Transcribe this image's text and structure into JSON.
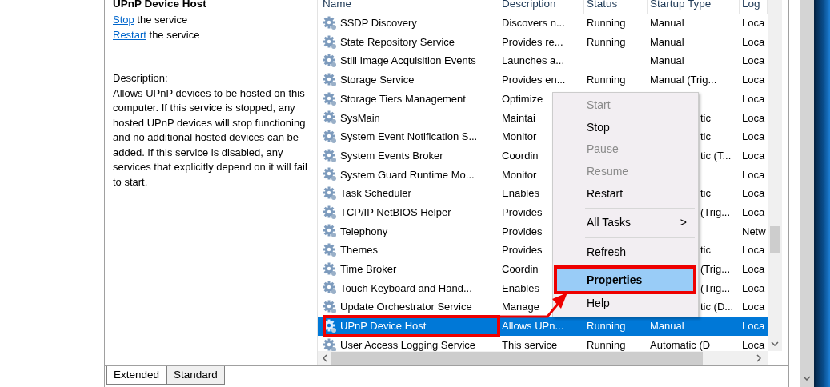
{
  "details": {
    "title": "UPnP Device Host",
    "actions": [
      {
        "link": "Stop",
        "text": "the service"
      },
      {
        "link": "Restart",
        "text": "the service"
      }
    ],
    "description_label": "Description:",
    "description": "Allows UPnP devices to be hosted on this computer. If this service is stopped, any hosted UPnP devices will stop functioning and no additional hosted devices can be added. If this service is disabled, any services that explicitly depend on it will fail to start."
  },
  "table": {
    "columns": [
      "Name",
      "Description",
      "Status",
      "Startup Type",
      "Log"
    ],
    "rows": [
      {
        "name": "SSDP Discovery",
        "description": "Discovers n...",
        "status": "Running",
        "startup": "Manual",
        "log": "Loca",
        "selected": false
      },
      {
        "name": "State Repository Service",
        "description": "Provides re...",
        "status": "Running",
        "startup": "Manual",
        "log": "Loca",
        "selected": false
      },
      {
        "name": "Still Image Acquisition Events",
        "description": "Launches a...",
        "status": "",
        "startup": "Manual",
        "log": "Loca",
        "selected": false
      },
      {
        "name": "Storage Service",
        "description": "Provides en...",
        "status": "Running",
        "startup": "Manual (Trig...",
        "log": "Loca",
        "selected": false
      },
      {
        "name": "Storage Tiers Management",
        "description": "Optimize",
        "startup_tail": "",
        "log": "Loca",
        "selected": false
      },
      {
        "name": "SysMain",
        "description": "Maintai",
        "startup_tail": "tic",
        "log": "Loca",
        "selected": false
      },
      {
        "name": "System Event Notification S...",
        "description": "Monitor",
        "startup_tail": "tic",
        "log": "Loca",
        "selected": false
      },
      {
        "name": "System Events Broker",
        "description": "Coordin",
        "startup_tail": "tic (T...",
        "log": "Loca",
        "selected": false
      },
      {
        "name": "System Guard Runtime Mo...",
        "description": "Monitor",
        "startup_tail": "",
        "log": "Loca",
        "selected": false
      },
      {
        "name": "Task Scheduler",
        "description": "Enables",
        "startup_tail": "tic",
        "log": "Loca",
        "selected": false
      },
      {
        "name": "TCP/IP NetBIOS Helper",
        "description": "Provides",
        "startup_tail": "(Trig...",
        "log": "Loca",
        "selected": false
      },
      {
        "name": "Telephony",
        "description": "Provides",
        "startup_tail": "",
        "log": "Netw",
        "selected": false
      },
      {
        "name": "Themes",
        "description": "Provides",
        "startup_tail": "tic",
        "log": "Loca",
        "selected": false
      },
      {
        "name": "Time Broker",
        "description": "Coordin",
        "startup_tail": "(Trig...",
        "log": "Loca",
        "selected": false
      },
      {
        "name": "Touch Keyboard and Hand...",
        "description": "Enables",
        "startup_tail": "(Trig...",
        "log": "Loca",
        "selected": false
      },
      {
        "name": "Update Orchestrator Service",
        "description": "Manage",
        "startup_tail": "tic (D...",
        "log": "Loca",
        "selected": false
      },
      {
        "name": "UPnP Device Host",
        "description": "Allows UPn...",
        "status": "Running",
        "startup": "Manual",
        "log": "Loca",
        "selected": true
      },
      {
        "name": "User Access Logging Service",
        "description": "This service",
        "status": "Running",
        "startup": "Automatic (D",
        "log": "Loca",
        "selected": false
      }
    ]
  },
  "context_menu": [
    {
      "kind": "item",
      "label": "Start",
      "disabled": true,
      "selected": false
    },
    {
      "kind": "item",
      "label": "Stop",
      "disabled": false,
      "selected": false
    },
    {
      "kind": "item",
      "label": "Pause",
      "disabled": true,
      "selected": false
    },
    {
      "kind": "item",
      "label": "Resume",
      "disabled": true,
      "selected": false
    },
    {
      "kind": "item",
      "label": "Restart",
      "disabled": false,
      "selected": false
    },
    {
      "kind": "separator"
    },
    {
      "kind": "submenu",
      "label": "All Tasks",
      "arrow": ">",
      "disabled": false,
      "selected": false
    },
    {
      "kind": "separator"
    },
    {
      "kind": "item",
      "label": "Refresh",
      "disabled": false,
      "selected": false
    },
    {
      "kind": "item",
      "label": "Properties",
      "disabled": false,
      "selected": true
    },
    {
      "kind": "item",
      "label": "Help",
      "disabled": false,
      "selected": false
    }
  ],
  "tabs": [
    {
      "label": "Extended",
      "selected": true
    },
    {
      "label": "Standard",
      "selected": false
    }
  ]
}
